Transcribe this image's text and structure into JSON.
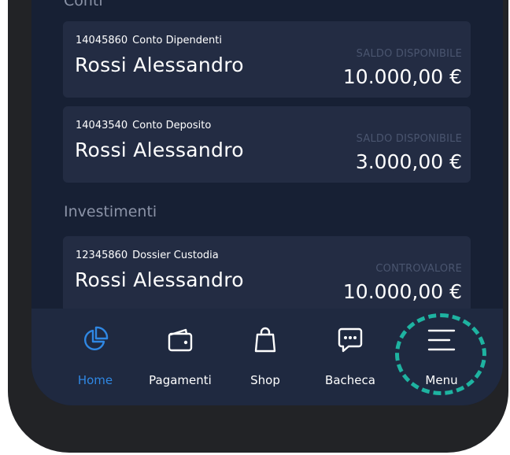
{
  "sections": {
    "accounts_title": "Conti",
    "investments_title": "Investimenti"
  },
  "accounts": [
    {
      "number": "14045860",
      "type": "Conto Dipendenti",
      "holder": "Rossi Alessandro",
      "balance_label": "SALDO DISPONIBILE",
      "balance": "10.000,00 €"
    },
    {
      "number": "14043540",
      "type": "Conto Deposito",
      "holder": "Rossi Alessandro",
      "balance_label": "SALDO DISPONIBILE",
      "balance": "3.000,00 €"
    }
  ],
  "investments": [
    {
      "number": "12345860",
      "type": "Dossier Custodia",
      "holder": "Rossi Alessandro",
      "balance_label": "CONTROVALORE",
      "balance": "10.000,00 €"
    }
  ],
  "nav": {
    "items": [
      {
        "label": "Home",
        "icon": "pie-chart-icon",
        "active": true
      },
      {
        "label": "Pagamenti",
        "icon": "wallet-icon",
        "active": false
      },
      {
        "label": "Shop",
        "icon": "shopping-bag-icon",
        "active": false
      },
      {
        "label": "Bacheca",
        "icon": "chat-bubble-icon",
        "active": false
      },
      {
        "label": "Menu",
        "icon": "menu-icon",
        "active": false
      }
    ],
    "highlighted": "Menu"
  },
  "colors": {
    "background": "#172034",
    "card": "#232c43",
    "nav_bg": "#1f2940",
    "accent": "#2f87e3",
    "highlight": "#1eb3a1",
    "muted_label": "#4a556f",
    "section_title": "#8b93a7"
  }
}
